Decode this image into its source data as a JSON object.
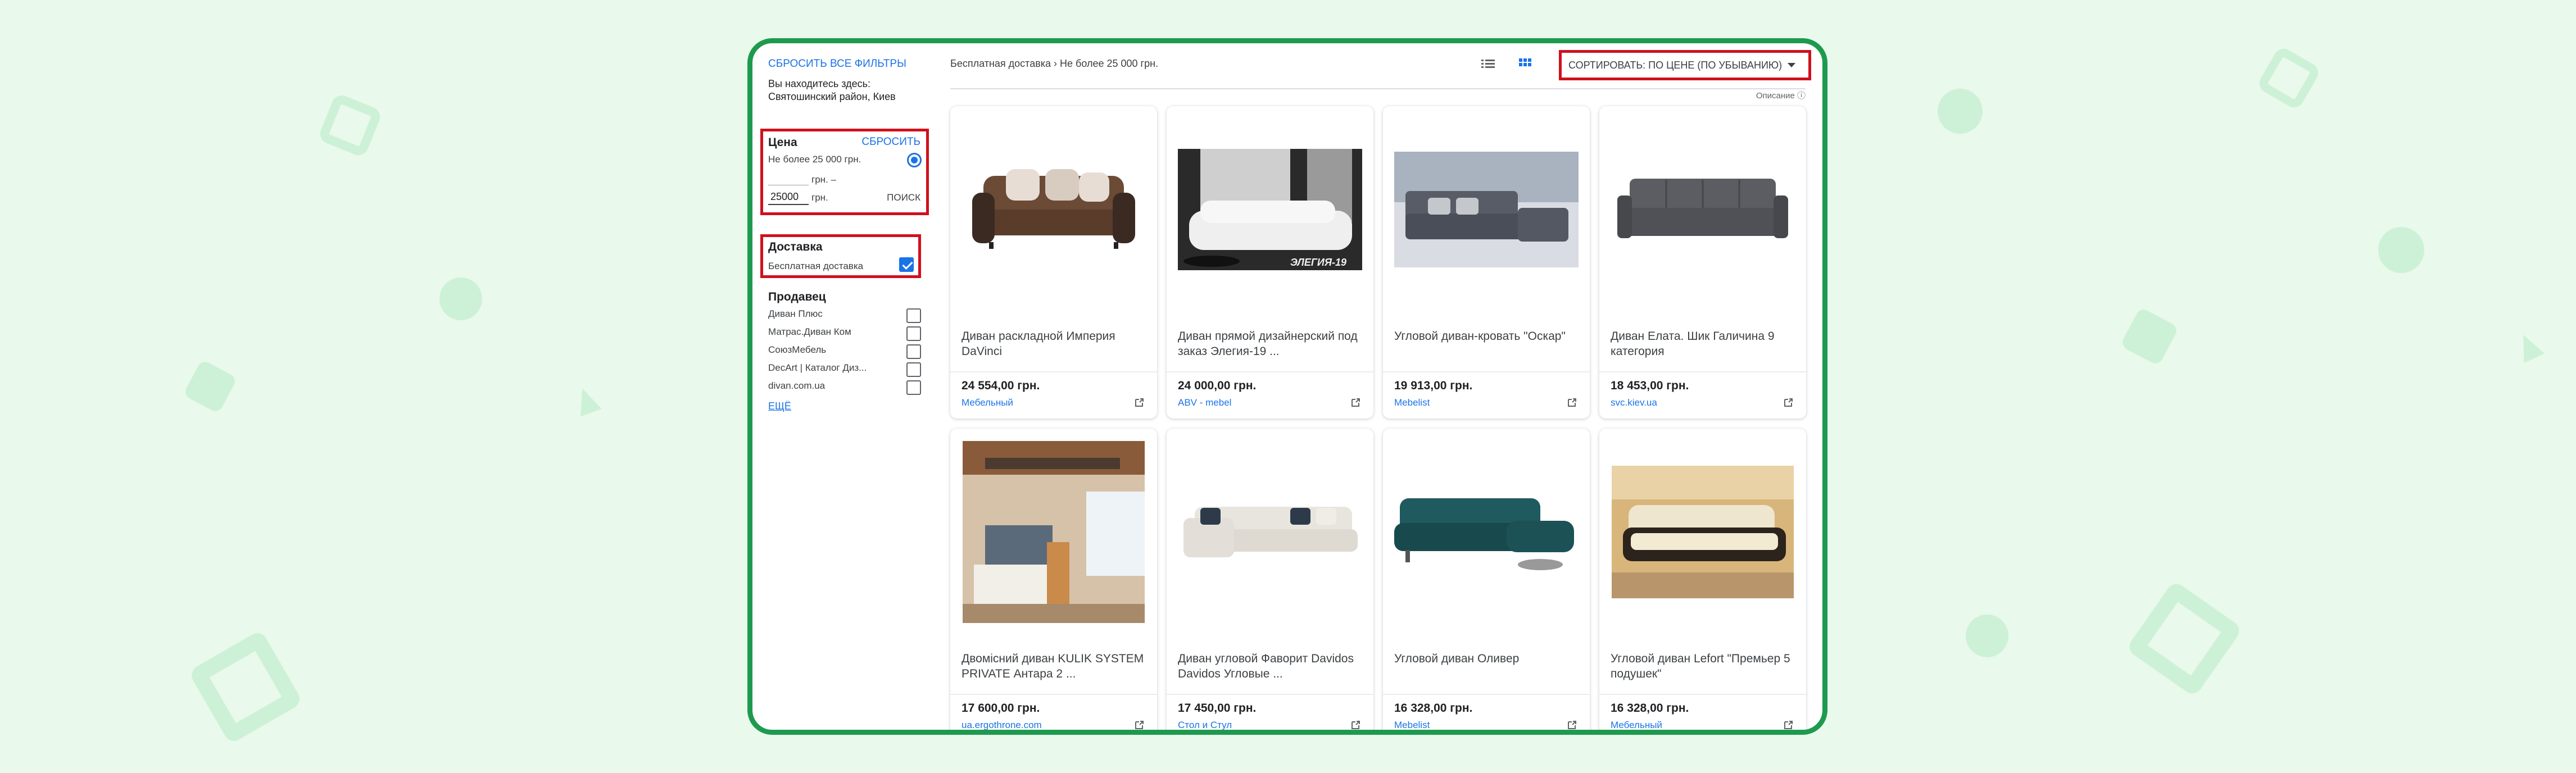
{
  "sidebar": {
    "reset_all": "СБРОСИТЬ ВСЕ ФИЛЬТРЫ",
    "location_label": "Вы находитесь здесь:",
    "location_value": "Святошинский район, Киев",
    "price": {
      "title": "Цена",
      "reset": "СБРОСИТЬ",
      "option": "Не более 25 000 грн.",
      "from_unit": "грн. –",
      "to_value": "25000",
      "to_unit": "грн.",
      "search": "ПОИСК"
    },
    "delivery": {
      "title": "Доставка",
      "option": "Бесплатная доставка"
    },
    "seller": {
      "title": "Продавец",
      "items": [
        "Диван Плюс",
        "Матрас.Диван Ком",
        "СоюзМебель",
        "DecArt | Каталог Диз...",
        "divan.com.ua"
      ],
      "more": "ЕЩЁ"
    }
  },
  "toolbar": {
    "breadcrumb": "Бесплатная доставка › Не более 25 000 грн.",
    "sort_label": "СОРТИРОВАТЬ: ПО ЦЕНЕ (ПО УБЫВАНИЮ)",
    "disclaimer": "Описание ⓘ",
    "list_icon": "list-view-icon",
    "grid_icon": "grid-view-icon"
  },
  "products": [
    {
      "title": "Диван раскладной Империя DaVinci",
      "price": "24 554,00 грн.",
      "seller": "Мебельный"
    },
    {
      "title": "Диван прямой дизайнерский под заказ Элегия-19 ...",
      "price": "24 000,00 грн.",
      "seller": "ABV - mebel"
    },
    {
      "title": "Угловой диван-кровать \"Оскар\"",
      "price": "19 913,00 грн.",
      "seller": "Mebelist"
    },
    {
      "title": "Диван Елата. Шик Галичина 9 категория",
      "price": "18 453,00 грн.",
      "seller": "svc.kiev.ua"
    },
    {
      "title": "Двомісний диван KULIK SYSTEM PRIVATE Антара 2 ...",
      "price": "17 600,00 грн.",
      "seller": "ua.ergothrone.com"
    },
    {
      "title": "Диван угловой Фаворит Davidos Davidos Угловые ...",
      "price": "17 450,00 грн.",
      "seller": "Стол и Стул"
    },
    {
      "title": "Угловой диван Оливер",
      "price": "16 328,00 грн.",
      "seller": "Mebelist"
    },
    {
      "title": "Угловой диван Lefort \"Премьер 5 подушек\"",
      "price": "16 328,00 грн.",
      "seller": "Мебельный"
    }
  ],
  "image_caption_2": "ЭЛЕГИЯ-19",
  "colors": {
    "accent": "#1a73e8",
    "highlight": "#d0101c",
    "frame": "#1e9a4f",
    "background": "#e9f9ec"
  }
}
